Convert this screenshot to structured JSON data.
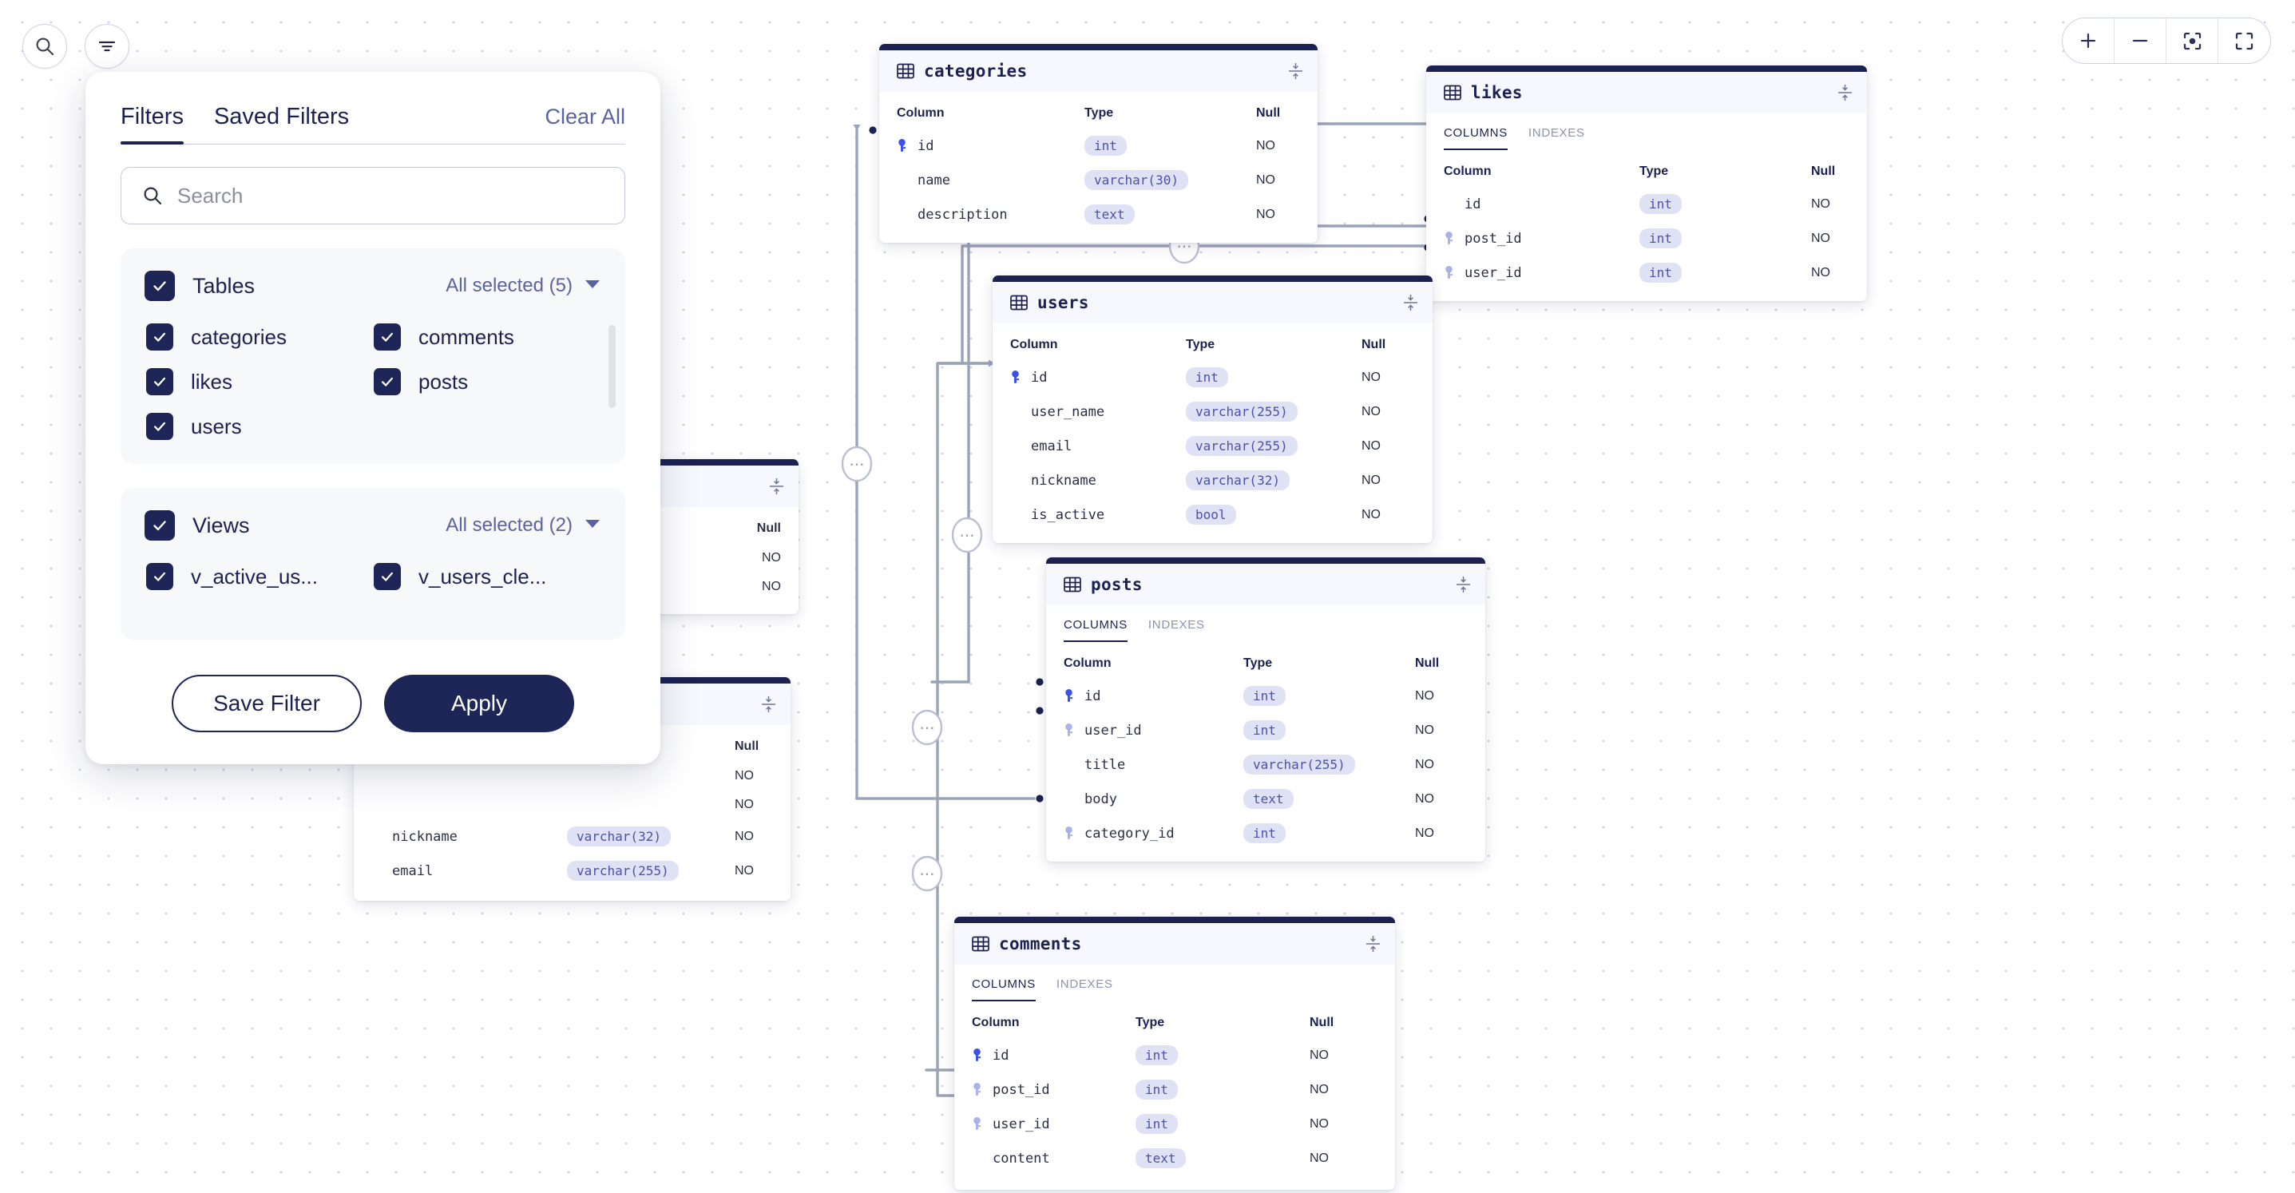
{
  "toolbar_left": [
    {
      "name": "search-icon",
      "label": "Search"
    },
    {
      "name": "filter-icon",
      "label": "Filter"
    }
  ],
  "zoom_toolbar": [
    {
      "name": "zoom-in-icon",
      "label": "Zoom In"
    },
    {
      "name": "zoom-out-icon",
      "label": "Zoom Out"
    },
    {
      "name": "center-focus-icon",
      "label": "Center"
    },
    {
      "name": "fullscreen-icon",
      "label": "Fullscreen"
    }
  ],
  "filter_panel": {
    "tabs": [
      {
        "label": "Filters",
        "active": true
      },
      {
        "label": "Saved Filters",
        "active": false
      }
    ],
    "clear_all": "Clear All",
    "search": {
      "value": "",
      "placeholder": "Search"
    },
    "groups": [
      {
        "title": "Tables",
        "selected_label": "All selected (5)",
        "checked": true,
        "items": [
          {
            "label": "categories",
            "checked": true
          },
          {
            "label": "comments",
            "checked": true
          },
          {
            "label": "likes",
            "checked": true
          },
          {
            "label": "posts",
            "checked": true
          },
          {
            "label": "users",
            "checked": true
          }
        ]
      },
      {
        "title": "Views",
        "selected_label": "All selected (2)",
        "checked": true,
        "items": [
          {
            "label": "v_active_us...",
            "checked": true
          },
          {
            "label": "v_users_cle...",
            "checked": true
          }
        ]
      }
    ],
    "actions": {
      "save": "Save Filter",
      "apply": "Apply"
    }
  },
  "column_headers": {
    "column": "Column",
    "type": "Type",
    "null": "Null"
  },
  "card_tabs": {
    "columns": "COLUMNS",
    "indexes": "INDEXES"
  },
  "tables": [
    {
      "name": "categories",
      "has_tabs": false,
      "rows": [
        {
          "col": "id",
          "type": "int",
          "null": "NO",
          "key": "pk"
        },
        {
          "col": "name",
          "type": "varchar(30)",
          "null": "NO",
          "key": ""
        },
        {
          "col": "description",
          "type": "text",
          "null": "NO",
          "key": ""
        }
      ]
    },
    {
      "name": "likes",
      "has_tabs": true,
      "rows": [
        {
          "col": "id",
          "type": "int",
          "null": "NO",
          "key": ""
        },
        {
          "col": "post_id",
          "type": "int",
          "null": "NO",
          "key": "fk"
        },
        {
          "col": "user_id",
          "type": "int",
          "null": "NO",
          "key": "fk"
        }
      ]
    },
    {
      "name": "users",
      "has_tabs": false,
      "rows": [
        {
          "col": "id",
          "type": "int",
          "null": "NO",
          "key": "pk"
        },
        {
          "col": "user_name",
          "type": "varchar(255)",
          "null": "NO",
          "key": ""
        },
        {
          "col": "email",
          "type": "varchar(255)",
          "null": "NO",
          "key": ""
        },
        {
          "col": "nickname",
          "type": "varchar(32)",
          "null": "NO",
          "key": ""
        },
        {
          "col": "is_active",
          "type": "bool",
          "null": "NO",
          "key": ""
        }
      ]
    },
    {
      "name": "posts",
      "has_tabs": true,
      "rows": [
        {
          "col": "id",
          "type": "int",
          "null": "NO",
          "key": "pk"
        },
        {
          "col": "user_id",
          "type": "int",
          "null": "NO",
          "key": "fk"
        },
        {
          "col": "title",
          "type": "varchar(255)",
          "null": "NO",
          "key": ""
        },
        {
          "col": "body",
          "type": "text",
          "null": "NO",
          "key": ""
        },
        {
          "col": "category_id",
          "type": "int",
          "null": "NO",
          "key": "fk"
        }
      ]
    },
    {
      "name": "comments",
      "has_tabs": true,
      "rows": [
        {
          "col": "id",
          "type": "int",
          "null": "NO",
          "key": "pk"
        },
        {
          "col": "post_id",
          "type": "int",
          "null": "NO",
          "key": "fk"
        },
        {
          "col": "user_id",
          "type": "int",
          "null": "NO",
          "key": "fk"
        },
        {
          "col": "content",
          "type": "text",
          "null": "NO",
          "key": ""
        }
      ]
    }
  ],
  "hidden_cards": [
    {
      "rows": [
        {
          "null": "NO"
        },
        {
          "null": "NO"
        }
      ]
    },
    {
      "rows": [
        {
          "null": "NO"
        },
        {
          "null": "NO"
        },
        {
          "col": "nickname",
          "type": "varchar(32)",
          "null": "NO"
        },
        {
          "col": "email",
          "type": "varchar(255)",
          "null": "NO"
        }
      ]
    }
  ],
  "colors": {
    "accent": "#1b2252",
    "primary_key": "#3b51e8",
    "foreign_key": "#a9b3ea",
    "chip_bg": "#dfe1f5",
    "chip_text": "#4b52a8",
    "edge": "#9aa3b8"
  }
}
